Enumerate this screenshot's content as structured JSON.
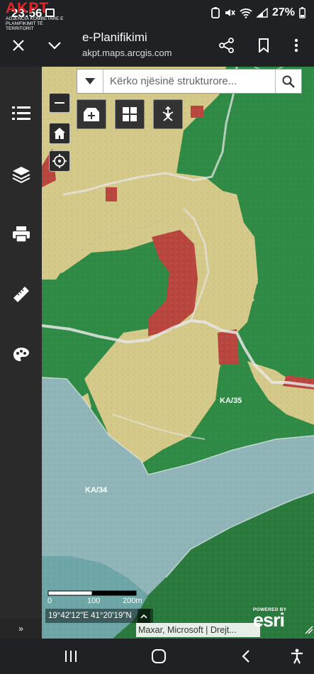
{
  "status_bar": {
    "time": "23:56",
    "battery": "27%"
  },
  "browser": {
    "title": "e-Planifikimi",
    "url": "akpt.maps.arcgis.com"
  },
  "logo": {
    "brand": "AKPT",
    "subtitle_line1": "AGJENCIA KOMBËTARE E",
    "subtitle_line2": "PLANIFIKIMIT TË TERRITORIT"
  },
  "search": {
    "placeholder": "Kërko njësinë strukturore..."
  },
  "map": {
    "parcel_labels": [
      "KA/35",
      "KA/34"
    ],
    "scale": {
      "ticks": [
        "0",
        "100",
        "200m"
      ]
    },
    "coordinates": "19°42'12\"E 41°20'19\"N",
    "attribution": "Maxar, Microsoft | Drejt...",
    "esri_powered": "POWERED BY",
    "esri_word": "esri",
    "colors": {
      "agricultural": "#d5c98a",
      "forest": "#2e8a45",
      "urban": "#b8463f",
      "water": "#8fb5b8"
    }
  },
  "sidebar": {
    "collapse_label": "»"
  }
}
